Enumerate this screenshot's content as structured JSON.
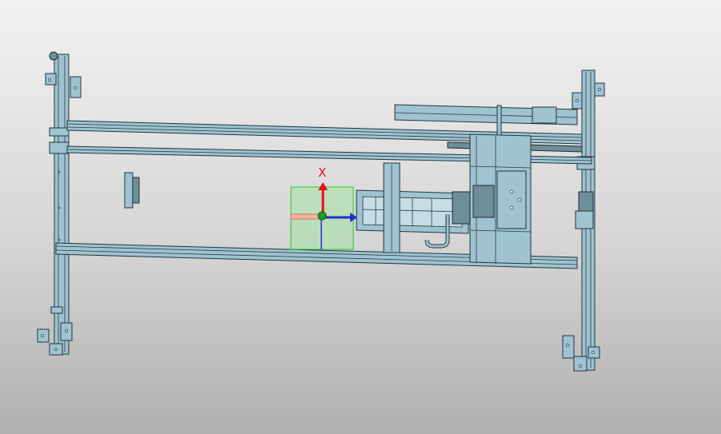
{
  "viewport": {
    "background_top": "#f2f2f2",
    "background_bottom": "#b0b0b0"
  },
  "model": {
    "part_color": "#9fc3d0",
    "edge_color": "#22343c"
  },
  "triad": {
    "x_label": "X",
    "x_axis_color": "#e8101a",
    "y_axis_color": "#1f2fd0",
    "z_axis_color": "#1f2fd0",
    "origin_color": "#1fa01f",
    "plane_color": "#9be59b"
  }
}
